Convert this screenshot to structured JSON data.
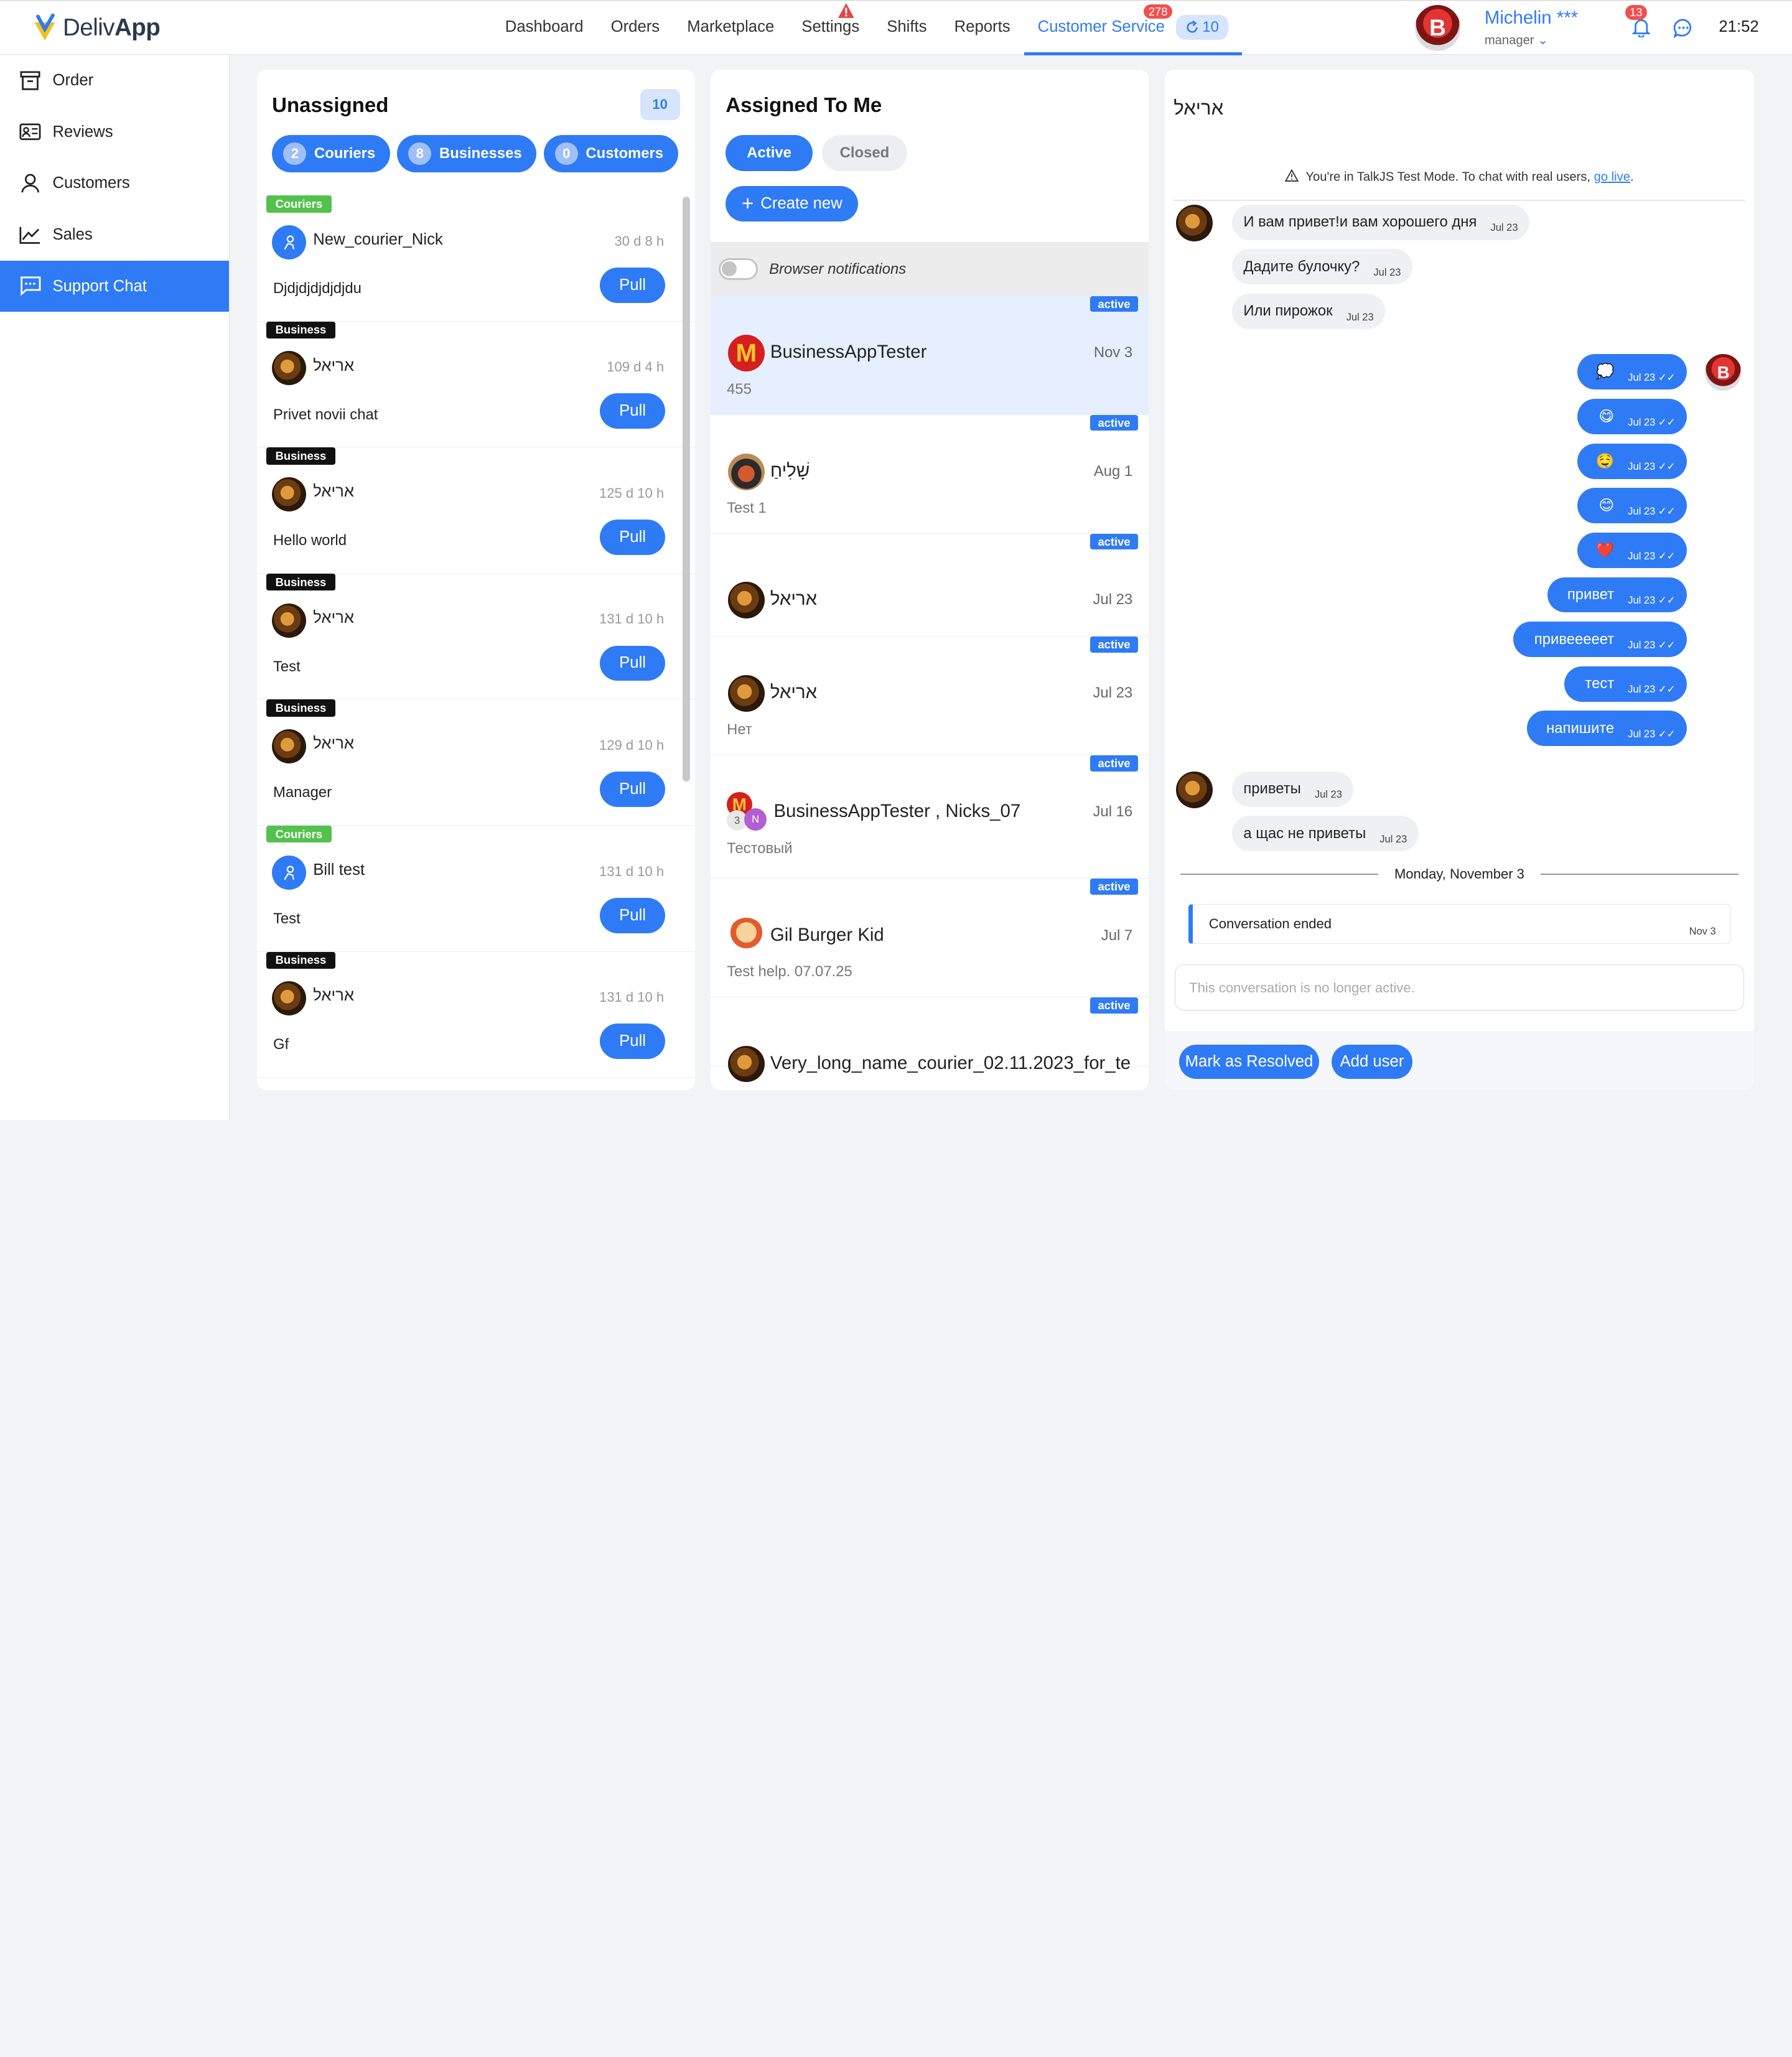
{
  "app": {
    "logo_prefix": "Deliv",
    "logo_bold": "App"
  },
  "nav": {
    "items": [
      "Dashboard",
      "Orders",
      "Marketplace",
      "Settings",
      "Shifts",
      "Reports",
      "Customer Service"
    ],
    "customer_service_badge": "278",
    "customer_service_pill": "10"
  },
  "user": {
    "name": "Michelin ***",
    "role": "manager",
    "avatar_letter": "B",
    "notification_count": "13",
    "time": "21:52"
  },
  "sidebar": {
    "items": [
      {
        "label": "Order",
        "icon": "archive-box-icon"
      },
      {
        "label": "Reviews",
        "icon": "reviews-icon"
      },
      {
        "label": "Customers",
        "icon": "person-icon"
      },
      {
        "label": "Sales",
        "icon": "chart-line-icon"
      },
      {
        "label": "Support Chat",
        "icon": "chat-dots-icon",
        "active": true
      }
    ]
  },
  "unassigned": {
    "title": "Unassigned",
    "count": "10",
    "filters": [
      {
        "num": "2",
        "label": "Couriers"
      },
      {
        "num": "8",
        "label": "Businesses"
      },
      {
        "num": "0",
        "label": "Customers"
      }
    ],
    "pull_label": "Pull",
    "items": [
      {
        "tag": "Couriers",
        "type": "courier",
        "name": "New_courier_Nick",
        "time": "30 d 8 h",
        "message": "Djdjdjdjdjdjdu"
      },
      {
        "tag": "Business",
        "type": "business",
        "name": "אריאל",
        "time": "109 d 4 h",
        "message": "Privet novii chat"
      },
      {
        "tag": "Business",
        "type": "business",
        "name": "אריאל",
        "time": "125 d 10 h",
        "message": "Hello world"
      },
      {
        "tag": "Business",
        "type": "business",
        "name": "אריאל",
        "time": "131 d 10 h",
        "message": "Test"
      },
      {
        "tag": "Business",
        "type": "business",
        "name": "אריאל",
        "time": "129 d 10 h",
        "message": "Manager"
      },
      {
        "tag": "Couriers",
        "type": "courier",
        "name": "Bill test",
        "time": "131 d 10 h",
        "message": "Test"
      },
      {
        "tag": "Business",
        "type": "business",
        "name": "אריאל",
        "time": "131 d 10 h",
        "message": "Gf"
      }
    ]
  },
  "assigned": {
    "title": "Assigned To Me",
    "tab_active": "Active",
    "tab_closed": "Closed",
    "create_label": "Create new",
    "notifications_label": "Browser notifications",
    "badge": "active",
    "items": [
      {
        "name": "BusinessAppTester",
        "date": "Nov 3",
        "sub": "455",
        "avatar": "mcdonalds-logo",
        "selected": true
      },
      {
        "name": "שָׁלִיחַ",
        "date": "Aug 1",
        "sub": "Test 1",
        "avatar": "hat"
      },
      {
        "name": "אריאל",
        "date": "Jul 23",
        "sub": "",
        "avatar": "food"
      },
      {
        "name": "אריאל",
        "date": "Jul 23",
        "sub": "Нет",
        "avatar": "food"
      },
      {
        "name": "BusinessAppTester , Nicks_07",
        "date": "Jul 16",
        "sub": "Тестовый",
        "avatar": "group",
        "group_count": "3",
        "group_initial": "N"
      },
      {
        "name": "Gil Burger Kid",
        "date": "Jul 7",
        "sub": "Test help. 07.07.25",
        "avatar": "kid"
      },
      {
        "name": "Very_long_name_courier_02.11.2023_for_te",
        "date": "",
        "sub": "",
        "avatar": "food"
      }
    ]
  },
  "chat": {
    "title": "אריאל",
    "test_mode_text": "You're in TalkJS Test Mode. To chat with real users, ",
    "test_mode_link": "go live",
    "test_mode_end": ".",
    "messages": [
      {
        "dir": "in",
        "text": "И вам привет!и вам хорошего дня",
        "time": "Jul 23"
      },
      {
        "dir": "in",
        "text": "Дадите булочку?",
        "time": "Jul 23"
      },
      {
        "dir": "in",
        "text": "Или пирожок",
        "time": "Jul 23"
      },
      {
        "dir": "out",
        "text": "💭",
        "time": "Jul 23 ✓✓"
      },
      {
        "dir": "out",
        "text": "😋",
        "time": "Jul 23 ✓✓"
      },
      {
        "dir": "out",
        "text": "🤤",
        "time": "Jul 23 ✓✓"
      },
      {
        "dir": "out",
        "text": "😊",
        "time": "Jul 23 ✓✓"
      },
      {
        "dir": "out",
        "text": "❤️",
        "time": "Jul 23 ✓✓"
      },
      {
        "dir": "out",
        "text": "привет",
        "time": "Jul 23 ✓✓"
      },
      {
        "dir": "out",
        "text": "привееееет",
        "time": "Jul 23 ✓✓"
      },
      {
        "dir": "out",
        "text": "тест",
        "time": "Jul 23 ✓✓"
      },
      {
        "dir": "out",
        "text": "напишите",
        "time": "Jul 23 ✓✓"
      },
      {
        "dir": "in",
        "text": "приветы",
        "time": "Jul 23"
      },
      {
        "dir": "in",
        "text": "а щас не приветы",
        "time": "Jul 23"
      }
    ],
    "day_separator": "Monday, November 3",
    "ended_text": "Conversation ended",
    "ended_date": "Nov 3",
    "inactive_placeholder": "This conversation is no longer active.",
    "resolve_label": "Mark as Resolved",
    "add_user_label": "Add user"
  },
  "colors": {
    "accent": "#2f7bf5",
    "courier_tag": "#53c24d",
    "business_tag": "#111111",
    "badge_red": "#f0504f"
  }
}
